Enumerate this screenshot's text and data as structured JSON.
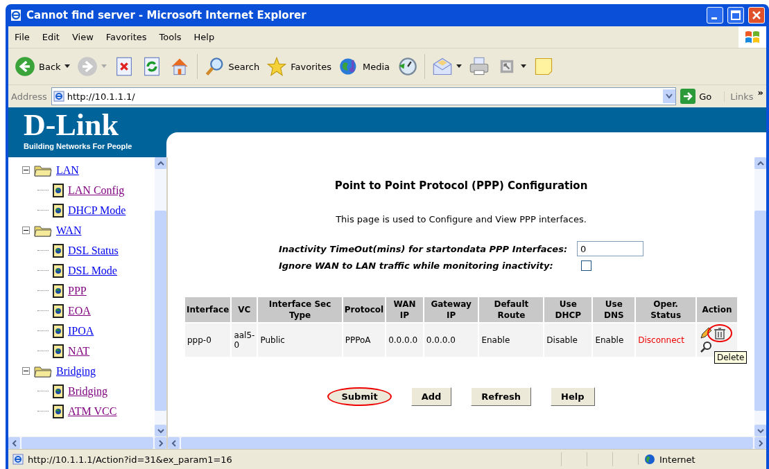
{
  "window": {
    "title": "Cannot find server - Microsoft Internet Explorer"
  },
  "menu": [
    "File",
    "Edit",
    "View",
    "Favorites",
    "Tools",
    "Help"
  ],
  "toolbar": [
    {
      "kind": "back",
      "label": "Back"
    },
    {
      "kind": "forward"
    },
    {
      "kind": "stop"
    },
    {
      "kind": "refresh"
    },
    {
      "kind": "home"
    },
    {
      "kind": "search",
      "label": "Search"
    },
    {
      "kind": "favorites",
      "label": "Favorites"
    },
    {
      "kind": "media",
      "label": "Media"
    },
    {
      "kind": "history"
    },
    {
      "kind": "mail"
    },
    {
      "kind": "print"
    },
    {
      "kind": "edit"
    },
    {
      "kind": "note"
    }
  ],
  "address_bar": {
    "label": "Address",
    "url": "http://10.1.1.1/",
    "go": "Go",
    "links": "Links",
    "more": "»"
  },
  "banner": {
    "logo": "D-Link",
    "tagline": "Building Networks For People"
  },
  "tree": [
    {
      "label": "LAN",
      "visited": false,
      "expanded": true,
      "children": [
        {
          "label": "LAN Config",
          "visited": true
        },
        {
          "label": "DHCP Mode",
          "visited": false
        }
      ]
    },
    {
      "label": "WAN",
      "visited": false,
      "expanded": true,
      "children": [
        {
          "label": "DSL Status",
          "visited": false
        },
        {
          "label": "DSL Mode",
          "visited": false
        },
        {
          "label": "PPP",
          "visited": true
        },
        {
          "label": "EOA",
          "visited": true
        },
        {
          "label": "IPOA",
          "visited": false
        },
        {
          "label": "NAT",
          "visited": true
        }
      ]
    },
    {
      "label": "Bridging",
      "visited": false,
      "expanded": true,
      "children": [
        {
          "label": "Bridging",
          "visited": true
        },
        {
          "label": "ATM VCC",
          "visited": true
        }
      ]
    }
  ],
  "page": {
    "title": "Point to Point Protocol (PPP) Configuration",
    "description": "This page is used to Configure and View PPP interfaces.",
    "settings": [
      {
        "kind": "text",
        "label": "Inactivity TimeOut(mins) for startondata PPP Interfaces:",
        "value": "0"
      },
      {
        "kind": "checkbox",
        "label": "Ignore WAN to LAN traffic while monitoring inactivity:",
        "checked": false
      }
    ],
    "table": {
      "columns": [
        "Interface",
        "VC",
        "Interface Sec Type",
        "Protocol",
        "WAN IP",
        "Gateway IP",
        "Default Route",
        "Use DHCP",
        "Use DNS",
        "Oper. Status",
        "Action"
      ],
      "rows": [
        {
          "cells": [
            "ppp-0",
            "aal5-0",
            "Public",
            "PPPoA",
            "0.0.0.0",
            "0.0.0.0",
            "Enable",
            "Disable",
            "Enable"
          ],
          "oper_status": {
            "text": "Disconnect",
            "connected": false
          },
          "actions": [
            {
              "kind": "edit",
              "highlighted": false
            },
            {
              "kind": "delete",
              "highlighted": true
            },
            {
              "kind": "view",
              "highlighted": false
            }
          ]
        }
      ]
    },
    "tooltip": "Delete",
    "buttons": [
      {
        "label": "Submit",
        "highlighted": true
      },
      {
        "label": "Add",
        "highlighted": false
      },
      {
        "label": "Refresh",
        "highlighted": false
      },
      {
        "label": "Help",
        "highlighted": false
      }
    ]
  },
  "status_bar": {
    "url": "http://10.1.1.1/Action?id=31&ex_param1=16",
    "zone": "Internet"
  }
}
